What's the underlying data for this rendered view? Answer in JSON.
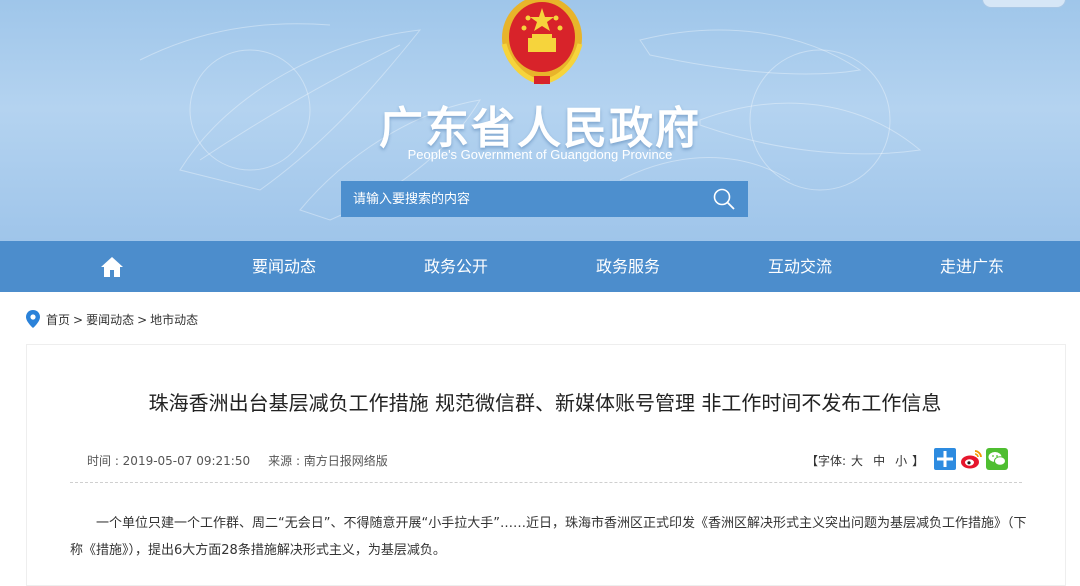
{
  "header": {
    "title": "广东省人民政府",
    "subtitle": "People's Government of Guangdong Province",
    "emblem_icon": "national-emblem-icon"
  },
  "search": {
    "placeholder": "请输入要搜索的内容",
    "value": ""
  },
  "nav": {
    "home_icon": "home-icon",
    "items": [
      {
        "label": "要闻动态"
      },
      {
        "label": "政务公开"
      },
      {
        "label": "政务服务"
      },
      {
        "label": "互动交流"
      },
      {
        "label": "走进广东"
      }
    ]
  },
  "breadcrumb": {
    "items": [
      "首页",
      "要闻动态",
      "地市动态"
    ],
    "separator": ">"
  },
  "article": {
    "title": "珠海香洲出台基层减负工作措施 规范微信群、新媒体账号管理 非工作时间不发布工作信息",
    "time": "时间 : 2019-05-07 09:21:50",
    "source": "来源 : 南方日报网络版",
    "font_size": {
      "open": "【字体:",
      "large": "大",
      "medium": "中",
      "small": "小",
      "close": "】"
    },
    "share_icons": [
      "plus-share-icon",
      "weibo-icon",
      "wechat-icon"
    ],
    "body": "一个单位只建一个工作群、周二“无会日”、不得随意开展“小手拉大手”……近日，珠海市香洲区正式印发《香洲区解决形式主义突出问题为基层减负工作措施》（下称《措施》），提出6大方面28条措施解决形式主义，为基层减负。"
  },
  "colors": {
    "banner": "#a9cdee",
    "nav": "#4c8dcc",
    "search_box": "#4d8fce",
    "share_plus": "#2d8be0",
    "weibo": "#e6162d",
    "wechat": "#4fbe31"
  }
}
